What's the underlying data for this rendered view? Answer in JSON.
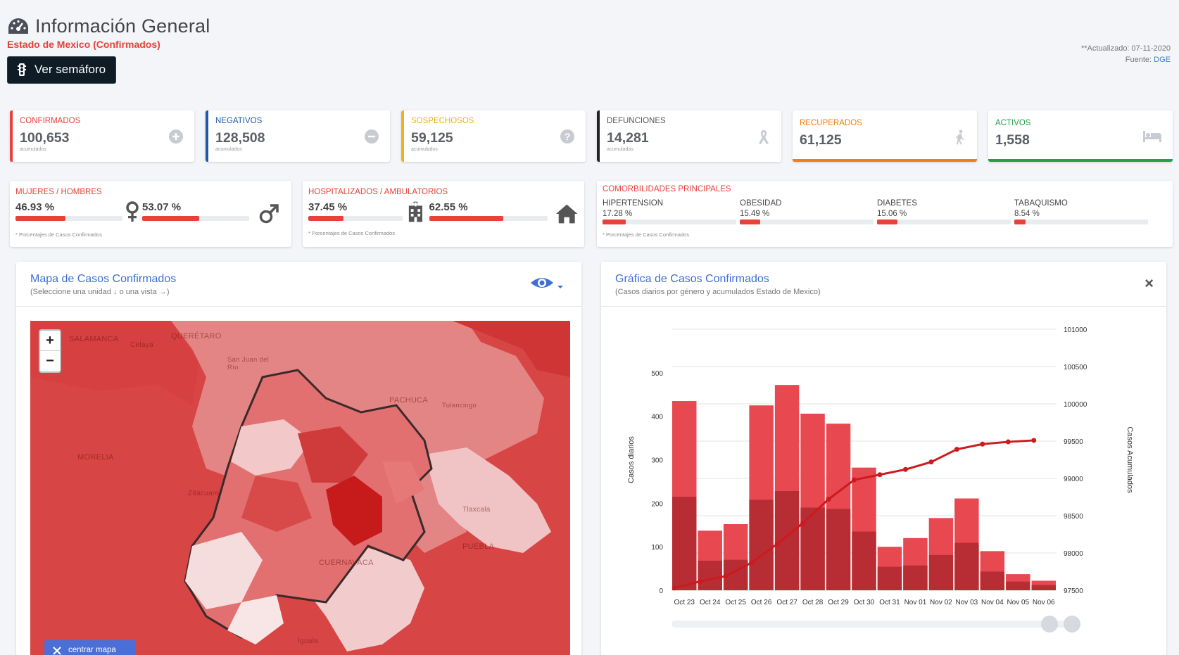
{
  "header": {
    "title": "Información General",
    "subtitle": "Estado de Mexico (Confirmados)",
    "semaforo_button": "Ver semáforo",
    "updated": "**Actualizado: 07-11-2020",
    "source_label": "Fuente:",
    "source_value": "DGE"
  },
  "stats": [
    {
      "label": "CONFIRMADOS",
      "value": "100,653",
      "sub": "acumulados",
      "color": "#e8403a",
      "icon": "plus-circle-icon"
    },
    {
      "label": "NEGATIVOS",
      "value": "128,508",
      "sub": "acumulados",
      "color": "#1f5aa6",
      "icon": "minus-circle-icon"
    },
    {
      "label": "SOSPECHOSOS",
      "value": "59,125",
      "sub": "acumulados",
      "color": "#f2b01e",
      "icon": "question-circle-icon"
    },
    {
      "label": "DEFUNCIONES",
      "value": "14,281",
      "sub": "acumuladas",
      "color": "#222222",
      "icon": "ribbon-icon"
    },
    {
      "label": "RECUPERADOS",
      "value": "61,125",
      "sub": "",
      "color": "#f07d1a",
      "icon": "walking-icon"
    },
    {
      "label": "ACTIVOS",
      "value": "1,558",
      "sub": "",
      "color": "#1fa04a",
      "icon": "bed-icon"
    }
  ],
  "gender": {
    "label": "MUJERES / HOMBRES",
    "women_pct": "46.93 %",
    "women_value": 46.93,
    "men_pct": "53.07 %",
    "men_value": 53.07,
    "note": "* Porcentajes  de Casos Confirmados"
  },
  "hospital": {
    "label": "HOSPITALIZADOS / AMBULATORIOS",
    "hosp_pct": "37.45 %",
    "hosp_value": 37.45,
    "amb_pct": "62.55 %",
    "amb_value": 62.55,
    "note": "* Porcentajes  de Casos Confirmados"
  },
  "comorbidities": {
    "label": "COMORBILIDADES PRINCIPALES",
    "items": [
      {
        "name": "HIPERTENSION",
        "pct": "17.28 %",
        "value": 17.28
      },
      {
        "name": "OBESIDAD",
        "pct": "15.49 %",
        "value": 15.49
      },
      {
        "name": "DIABETES",
        "pct": "15.06 %",
        "value": 15.06
      },
      {
        "name": "TABAQUISMO",
        "pct": "8.54 %",
        "value": 8.54
      }
    ],
    "note": "* Porcentajes  de Casos Confirmados"
  },
  "map_panel": {
    "title": "Mapa de Casos Confirmados",
    "subtitle": "(Seleccione una unidad ↓ o una vista →)",
    "center_button": "centrar mapa",
    "zoom_in": "+",
    "zoom_out": "−",
    "place_labels": [
      "SALAMANCA",
      "Celaya",
      "QUERÉTARO",
      "San Juan del Río",
      "PACHUCA",
      "Tulancingo",
      "MORELIA",
      "Zitácuaro",
      "Tlaxcala",
      "PUEBLA",
      "CUERNAVACA",
      "Iguala"
    ]
  },
  "chart_panel": {
    "title": "Gráfica de Casos Confirmados",
    "subtitle": "(Casos diarios por género y acumulados Estado de Mexico)",
    "close": "×"
  },
  "chart_data": {
    "type": "bar",
    "categories": [
      "Oct 23",
      "Oct 24",
      "Oct 25",
      "Oct 26",
      "Oct 27",
      "Oct 28",
      "Oct 29",
      "Oct 30",
      "Oct 31",
      "Nov 01",
      "Nov 02",
      "Nov 03",
      "Nov 04",
      "Nov 05",
      "Nov 06"
    ],
    "series": [
      {
        "values": [
          435,
          137,
          152,
          425,
          472,
          406,
          383,
          282,
          100,
          120,
          166,
          211,
          90,
          37,
          22
        ],
        "color": "#e8484f",
        "axis": "left",
        "type": "bar"
      },
      {
        "values": [
          215,
          68,
          70,
          208,
          228,
          190,
          187,
          135,
          54,
          57,
          81,
          109,
          43,
          20,
          12
        ],
        "color": "#b82c34",
        "axis": "left",
        "type": "bar"
      },
      {
        "values": [
          97530,
          97620,
          97690,
          97870,
          98120,
          98400,
          98720,
          98980,
          99050,
          99120,
          99220,
          99390,
          99460,
          99490,
          99510
        ],
        "color": "#cc1a1f",
        "axis": "right",
        "type": "line"
      }
    ],
    "ylabel": "Casos diarios",
    "y2label": "Casos Acumulados",
    "ylim": [
      0,
      600
    ],
    "y2lim": [
      97500,
      101000
    ],
    "yticks": [
      0,
      100,
      200,
      300,
      400,
      500
    ],
    "y2ticks": [
      97500,
      98000,
      98500,
      99000,
      99500,
      100000,
      100500,
      101000
    ],
    "grid": true
  }
}
